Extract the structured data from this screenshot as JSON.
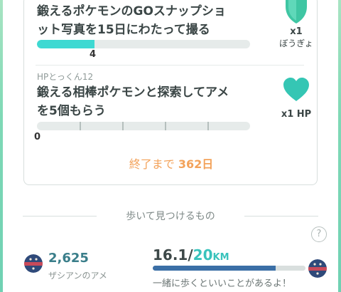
{
  "tasks": [
    {
      "title_line1": "鍛えるポケモンのGOスナップショ",
      "title_line2": "ット写真を15日にわたって撮る",
      "progress_value": "4",
      "progress_fraction": 0.27,
      "segments": 1,
      "reward_qty": "x1",
      "reward_name": "ぼうぎょ",
      "reward_icon": "shield-icon",
      "reward_color": "#3fc6a3"
    },
    {
      "category": "HPとっくん12",
      "title_line1": "鍛える相棒ポケモンと探索してアメ",
      "title_line2": "を5個もらう",
      "progress_value": "0",
      "progress_fraction": 0,
      "segments": 5,
      "reward_qty": "x1 HP",
      "reward_icon": "heart-icon",
      "reward_color": "#35c6b4"
    }
  ],
  "ends": {
    "label": "終了まで",
    "value": "362日"
  },
  "buddy": {
    "section_title": "歩いて見つけるもの",
    "help_label": "?",
    "candy_count": "2,625",
    "candy_name": "ザシアンのアメ",
    "candy_icon": "candy-icon",
    "distance_current": "16.1",
    "distance_sep": "/",
    "distance_goal": "20",
    "distance_unit": "KM",
    "distance_fraction": 0.805,
    "message": "一緒に歩くといいことがあるよ！"
  }
}
